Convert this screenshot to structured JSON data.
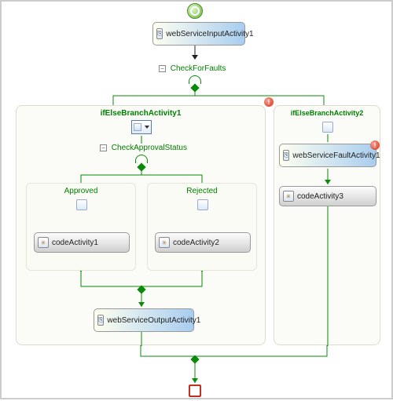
{
  "top_activity": {
    "name": "webServiceInputActivity1"
  },
  "ifelse_root": {
    "title": "CheckForFaults",
    "branch1": {
      "title": "ifElseBranchActivity1",
      "sub_ifelse": {
        "title": "CheckApprovalStatus",
        "approved": {
          "title": "Approved",
          "activity": "codeActivity1"
        },
        "rejected": {
          "title": "Rejected",
          "activity": "codeActivity2"
        }
      },
      "output_activity": {
        "name": "webServiceOutputActivity1"
      }
    },
    "branch2": {
      "title": "ifElseBranchActivity2",
      "fault_activity": {
        "name": "webServiceFaultActivity1"
      },
      "code_activity": {
        "name": "codeActivity3"
      }
    }
  }
}
